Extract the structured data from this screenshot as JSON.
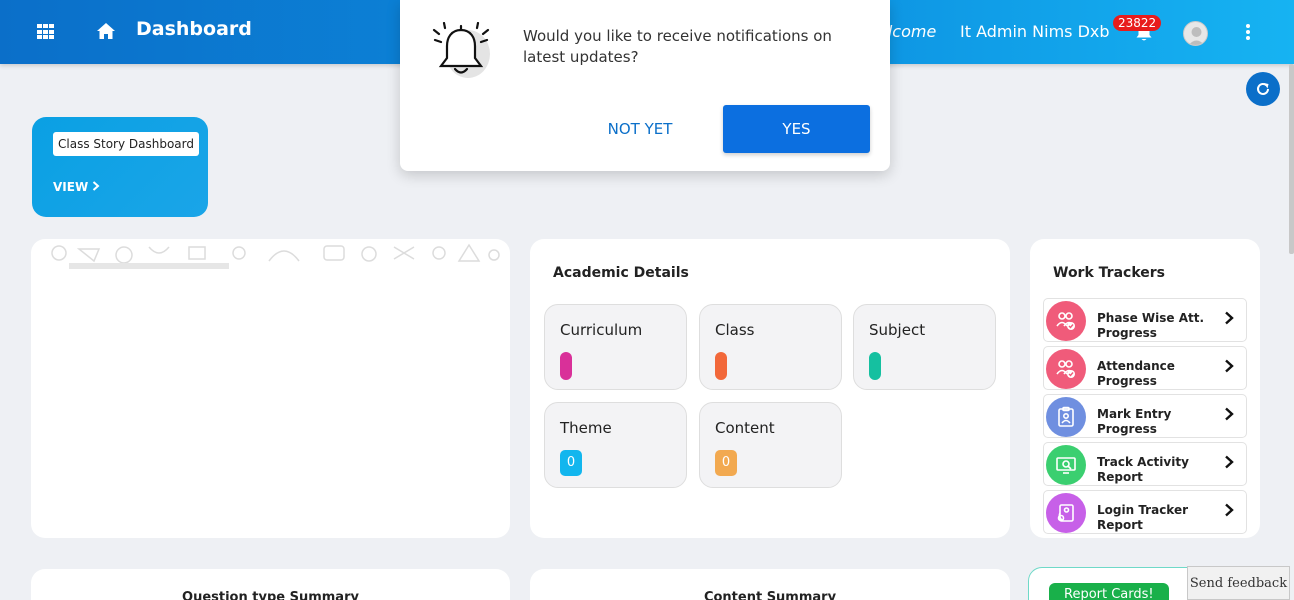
{
  "header": {
    "title": "Dashboard",
    "welcome_text": "elcome",
    "user_name": "It Admin Nims Dxb",
    "notification_count": "23822",
    "icons": [
      "apps-grid-icon",
      "home-icon",
      "bell-icon",
      "avatar",
      "more-vert-icon"
    ]
  },
  "class_story": {
    "label": "Class Story Dashboard",
    "view_label": "VIEW"
  },
  "academic": {
    "title": "Academic Details",
    "items": [
      {
        "label": "Curriculum",
        "count": "",
        "color": "#d93099"
      },
      {
        "label": "Class",
        "count": "",
        "color": "#f2683a"
      },
      {
        "label": "Subject",
        "count": "",
        "color": "#15c0a0"
      },
      {
        "label": "Theme",
        "count": "0",
        "color": "#12b6ee"
      },
      {
        "label": "Content",
        "count": "0",
        "color": "#f2a950"
      }
    ]
  },
  "work_trackers": {
    "title": "Work Trackers",
    "items": [
      {
        "label": "Phase Wise Att. Progress",
        "color": "#f05b7a",
        "icon": "group-check-icon"
      },
      {
        "label": "Attendance Progress",
        "color": "#f05b7a",
        "icon": "group-check-icon"
      },
      {
        "label": "Mark Entry Progress",
        "color": "#6f8fe0",
        "icon": "clipboard-icon"
      },
      {
        "label": "Track Activity Report",
        "color": "#3bcf70",
        "icon": "monitor-search-icon"
      },
      {
        "label": "Login Tracker Report",
        "color": "#c760e8",
        "icon": "login-tracker-icon"
      }
    ]
  },
  "bottom": {
    "question_summary": "Question type Summary",
    "content_summary": "Content Summary",
    "report_cards": "Report Cards!"
  },
  "feedback": "Send feedback",
  "popup": {
    "message": "Would you like to receive notifications on latest updates?",
    "not_yet": "NOT YET",
    "yes": "YES"
  }
}
